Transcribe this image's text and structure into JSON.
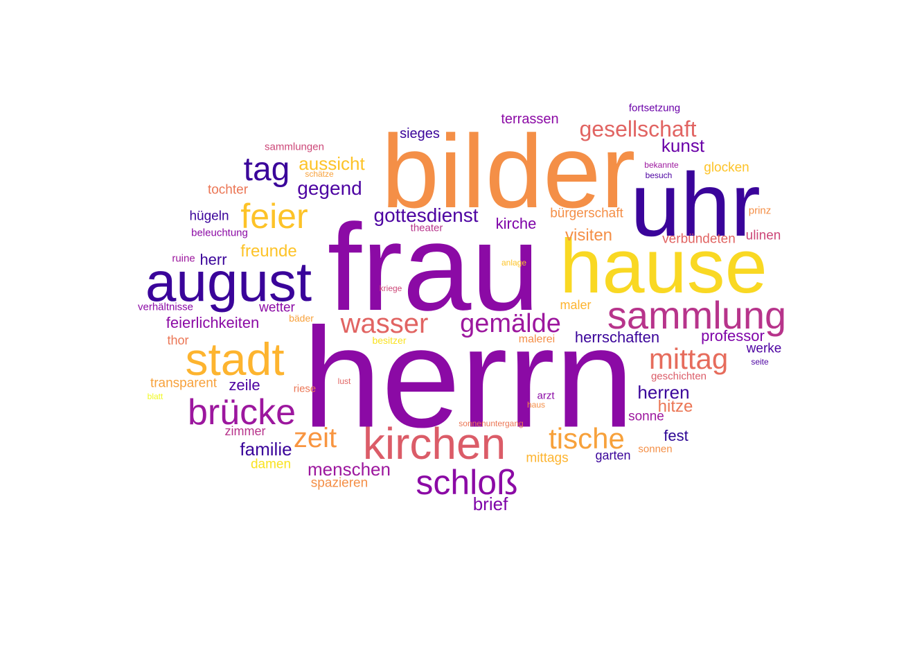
{
  "words": [
    {
      "text": "herrn",
      "color": "#8b0aa5"
    },
    {
      "text": "frau",
      "color": "#8b0aa5"
    },
    {
      "text": "bilder",
      "color": "#f48f47"
    },
    {
      "text": "hause",
      "color": "#f9d823"
    },
    {
      "text": "uhr",
      "color": "#3a049a"
    },
    {
      "text": "august",
      "color": "#3a049a"
    },
    {
      "text": "kirchen",
      "color": "#db5c68"
    },
    {
      "text": "sammlung",
      "color": "#b7348b"
    },
    {
      "text": "stadt",
      "color": "#fdb42f"
    },
    {
      "text": "brücke",
      "color": "#9c179e"
    },
    {
      "text": "tag",
      "color": "#3a049a"
    },
    {
      "text": "feier",
      "color": "#fdc328"
    },
    {
      "text": "wasser",
      "color": "#e16462"
    },
    {
      "text": "gemälde",
      "color": "#9c179e"
    },
    {
      "text": "mittag",
      "color": "#e66c5c"
    },
    {
      "text": "schloß",
      "color": "#8b0aa5"
    },
    {
      "text": "tische",
      "color": "#f7a13b"
    },
    {
      "text": "zeit",
      "color": "#f89540"
    },
    {
      "text": "gesellschaft",
      "color": "#e16462"
    },
    {
      "text": "gegend",
      "color": "#4c02a1"
    },
    {
      "text": "aussicht",
      "color": "#fdc328"
    },
    {
      "text": "gottesdienst",
      "color": "#4c02a1"
    },
    {
      "text": "kunst",
      "color": "#6a00a8"
    },
    {
      "text": "freunde",
      "color": "#fdc328"
    },
    {
      "text": "sieges",
      "color": "#3a049a"
    },
    {
      "text": "terrassen",
      "color": "#8b0aa5"
    },
    {
      "text": "fortsetzung",
      "color": "#6a00a8"
    },
    {
      "text": "sammlungen",
      "color": "#cc4778"
    },
    {
      "text": "tochter",
      "color": "#eb7655"
    },
    {
      "text": "hügeln",
      "color": "#3a049a"
    },
    {
      "text": "beleuchtung",
      "color": "#8b0aa5"
    },
    {
      "text": "ruine",
      "color": "#9c179e"
    },
    {
      "text": "herr",
      "color": "#3a049a"
    },
    {
      "text": "verhältnisse",
      "color": "#8b0aa5"
    },
    {
      "text": "wetter",
      "color": "#8b0aa5"
    },
    {
      "text": "feierlichkeiten",
      "color": "#8b0aa5"
    },
    {
      "text": "thor",
      "color": "#eb7655"
    },
    {
      "text": "transparent",
      "color": "#f7a13b"
    },
    {
      "text": "blatt",
      "color": "#f0f921"
    },
    {
      "text": "zeile",
      "color": "#4c02a1"
    },
    {
      "text": "zimmer",
      "color": "#b7348b"
    },
    {
      "text": "familie",
      "color": "#3a049a"
    },
    {
      "text": "damen",
      "color": "#f9e221"
    },
    {
      "text": "menschen",
      "color": "#9c179e"
    },
    {
      "text": "spazieren",
      "color": "#f48f47"
    },
    {
      "text": "brief",
      "color": "#7e03a8"
    },
    {
      "text": "bäder",
      "color": "#f7a13b"
    },
    {
      "text": "besitzer",
      "color": "#f9e221"
    },
    {
      "text": "riese",
      "color": "#eb7655"
    },
    {
      "text": "lust",
      "color": "#e16462"
    },
    {
      "text": "kriege",
      "color": "#cc4778"
    },
    {
      "text": "anlage",
      "color": "#fdc328"
    },
    {
      "text": "theater",
      "color": "#b7348b"
    },
    {
      "text": "kirche",
      "color": "#7e03a8"
    },
    {
      "text": "visiten",
      "color": "#f48f47"
    },
    {
      "text": "maler",
      "color": "#fdb42f"
    },
    {
      "text": "malerei",
      "color": "#f48f47"
    },
    {
      "text": "herrschaften",
      "color": "#3a049a"
    },
    {
      "text": "professor",
      "color": "#7e03a8"
    },
    {
      "text": "werke",
      "color": "#4c02a1"
    },
    {
      "text": "seite",
      "color": "#4c02a1"
    },
    {
      "text": "geschichten",
      "color": "#db5c68"
    },
    {
      "text": "herren",
      "color": "#3a049a"
    },
    {
      "text": "hitze",
      "color": "#eb7655"
    },
    {
      "text": "arzt",
      "color": "#8b0aa5"
    },
    {
      "text": "haus",
      "color": "#f48f47"
    },
    {
      "text": "sonnenuntergang",
      "color": "#eb7655"
    },
    {
      "text": "sonne",
      "color": "#9c179e"
    },
    {
      "text": "fest",
      "color": "#2c0594"
    },
    {
      "text": "sonnen",
      "color": "#f48f47"
    },
    {
      "text": "garten",
      "color": "#3a049a"
    },
    {
      "text": "mittags",
      "color": "#fdb42f"
    },
    {
      "text": "bürgerschaft",
      "color": "#f48f47"
    },
    {
      "text": "verbündeten",
      "color": "#e16462"
    },
    {
      "text": "ulinen",
      "color": "#cc4778"
    },
    {
      "text": "prinz",
      "color": "#f48f47"
    },
    {
      "text": "glocken",
      "color": "#fdc328"
    },
    {
      "text": "bekannte",
      "color": "#9c179e"
    },
    {
      "text": "besuch",
      "color": "#4c02a1"
    },
    {
      "text": "schätze",
      "color": "#f7a13b"
    }
  ]
}
